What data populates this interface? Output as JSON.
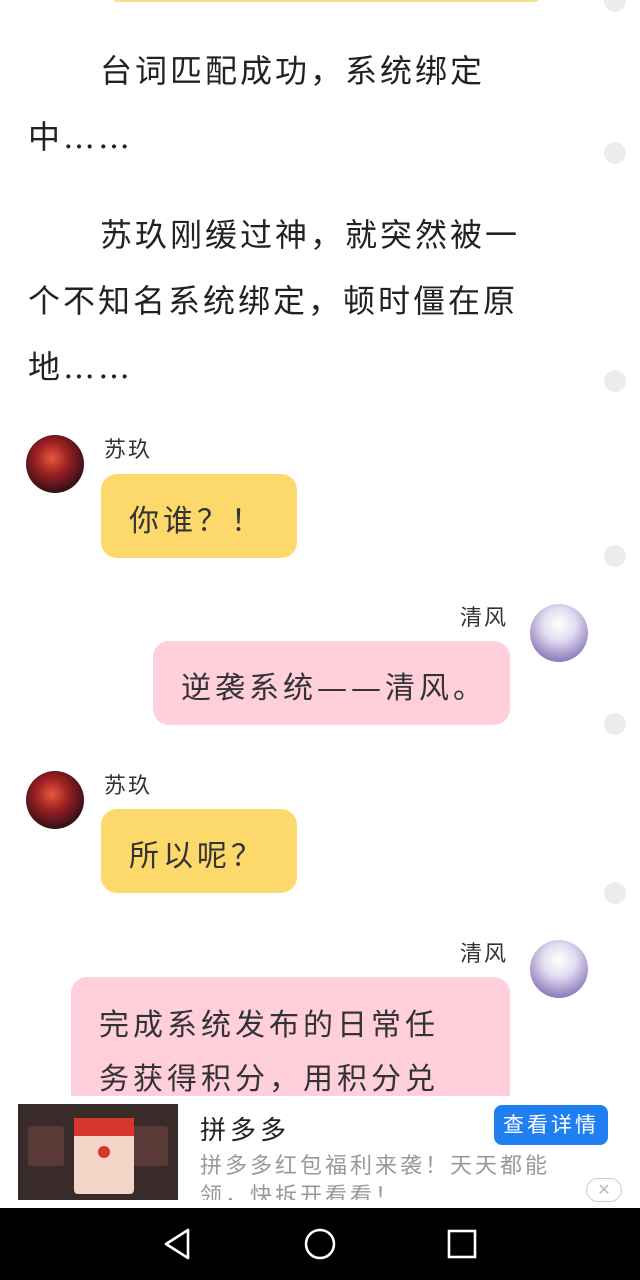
{
  "story": {
    "paragraphs": [
      "台词匹配成功，系统绑定中……",
      "苏玖刚缓过神，就突然被一个不知名系统绑定，顿时僵在原地……"
    ]
  },
  "chat": {
    "messages": [
      {
        "speaker": "苏玖",
        "text": "你谁？！",
        "side": "left",
        "color": "#fdd96b"
      },
      {
        "speaker": "清风",
        "text": "逆袭系统——清风。",
        "side": "right",
        "color": "#ffcfdc"
      },
      {
        "speaker": "苏玖",
        "text": "所以呢？",
        "side": "left",
        "color": "#fdd96b"
      },
      {
        "speaker": "清风",
        "text": "完成系统发布的日常任务获得积分，用积分兑",
        "side": "right",
        "color": "#ffcfdc"
      }
    ]
  },
  "ad": {
    "title": "拼多多",
    "description": "拼多多红包福利来袭！天天都能领，快拆开看看！",
    "cta_label": "查看详情",
    "close_icon": "close-icon",
    "thumbnail": "ad-thumbnail-image"
  },
  "navbar": {
    "icons": [
      "back-triangle-icon",
      "home-circle-icon",
      "recents-square-icon"
    ]
  },
  "colors": {
    "yellow_bubble": "#fdd96b",
    "pink_bubble": "#ffcfdc",
    "cta_blue": "#1f7ff0"
  }
}
